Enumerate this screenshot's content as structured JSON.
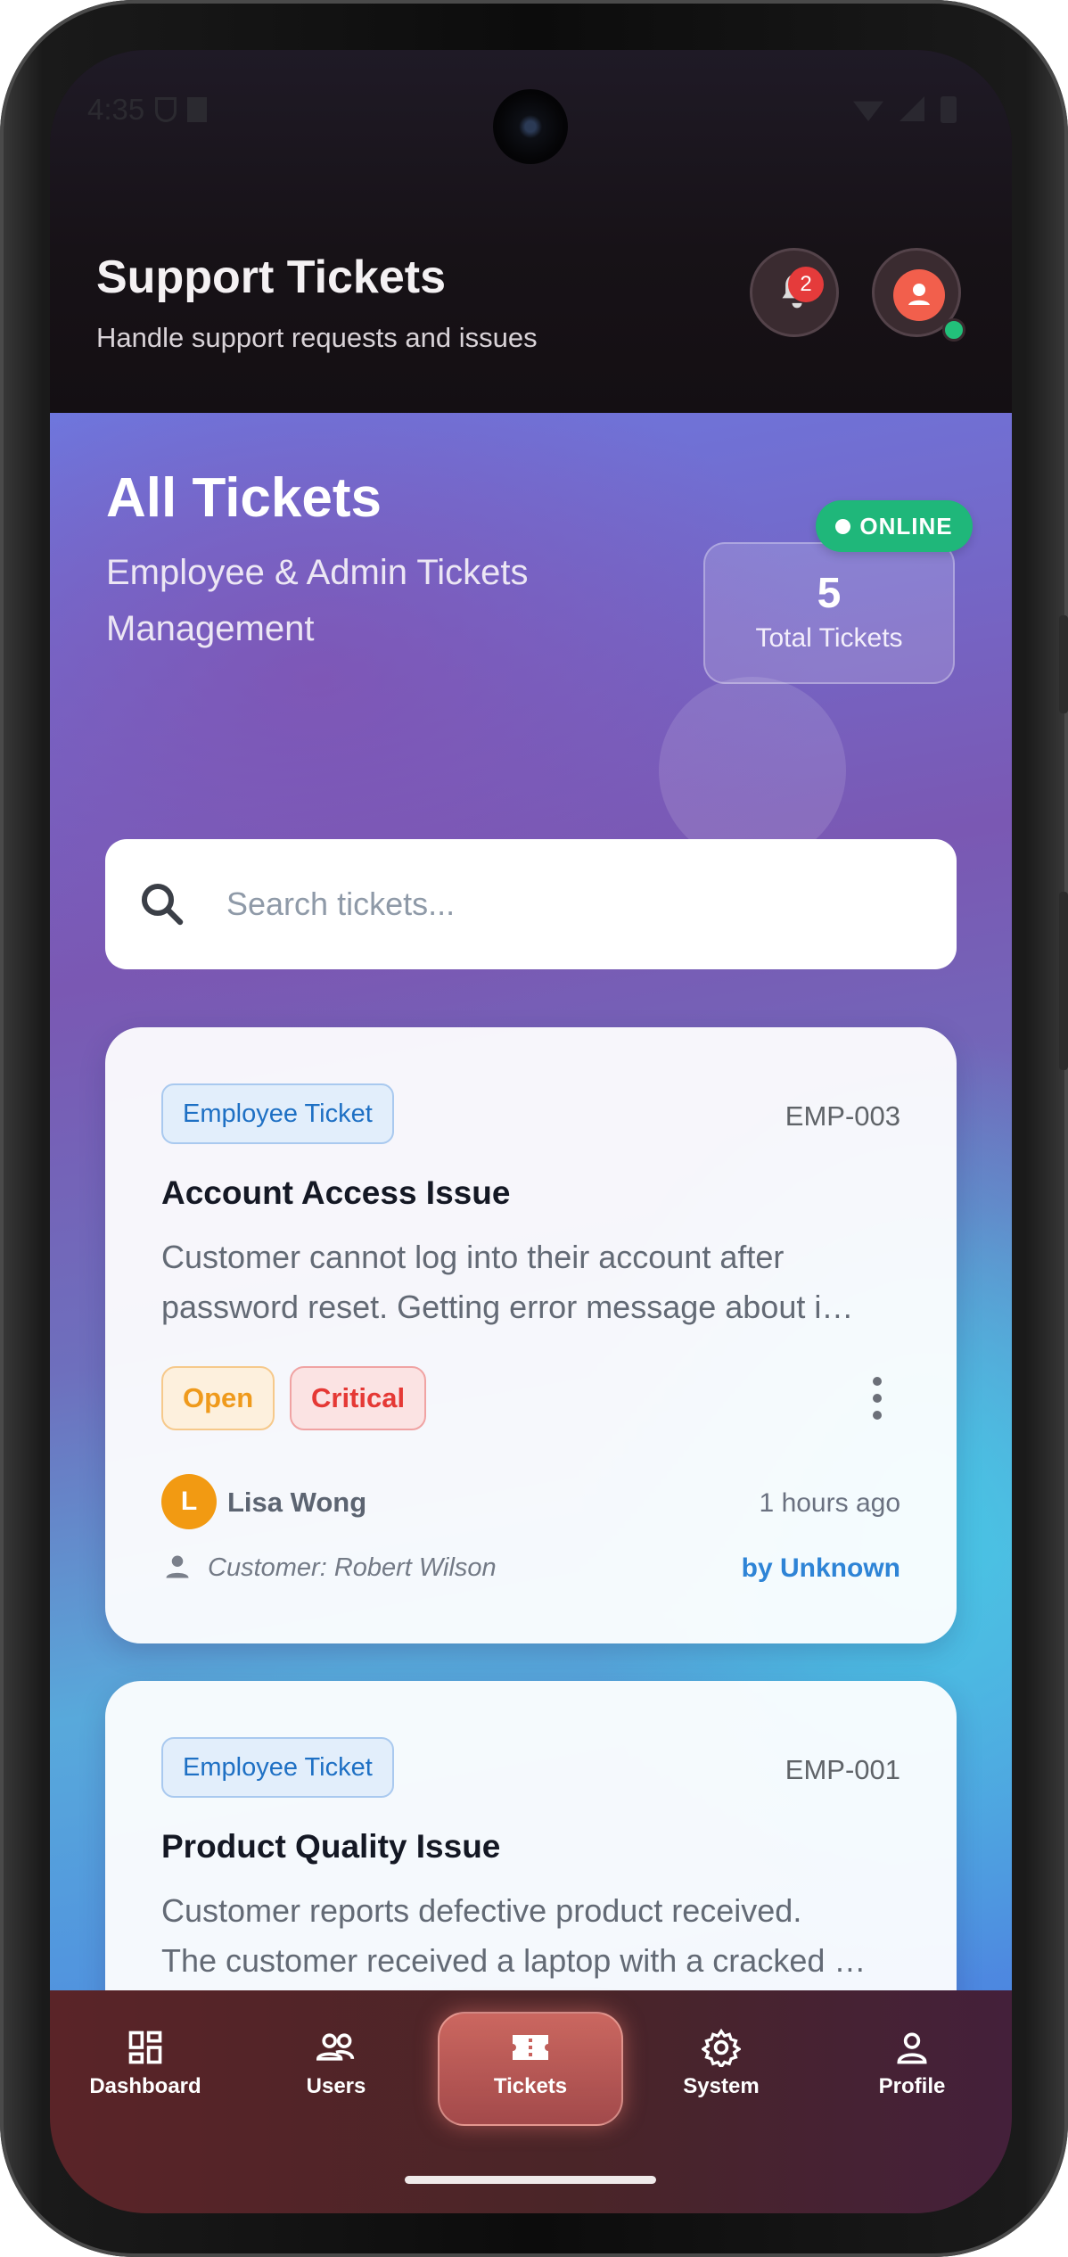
{
  "status_bar": {
    "time": "4:35"
  },
  "header": {
    "title": "Support Tickets",
    "subtitle": "Handle support requests and issues",
    "notification_count": "2"
  },
  "hero": {
    "title": "All Tickets",
    "subtitle": "Employee & Admin Tickets Management",
    "total_count": "5",
    "total_label": "Total Tickets",
    "online_label": "ONLINE"
  },
  "search": {
    "placeholder": "Search tickets..."
  },
  "tickets": [
    {
      "type": "Employee Ticket",
      "id": "EMP-003",
      "title": "Account Access Issue",
      "desc_line1": "Customer cannot log into their account after",
      "desc_line2": "password reset. Getting error message about i…",
      "status": "Open",
      "priority": "Critical",
      "assignee_initial": "L",
      "assignee": "Lisa Wong",
      "time": "1 hours ago",
      "customer": "Customer: Robert Wilson",
      "created_by": "by Unknown"
    },
    {
      "type": "Employee Ticket",
      "id": "EMP-001",
      "title": "Product Quality Issue",
      "desc_line1": "Customer reports defective product received.",
      "desc_line2": "The customer received a laptop with a cracked …"
    }
  ],
  "nav": {
    "items": [
      {
        "label": "Dashboard",
        "icon": "dashboard-icon"
      },
      {
        "label": "Users",
        "icon": "users-icon"
      },
      {
        "label": "Tickets",
        "icon": "ticket-icon",
        "active": true
      },
      {
        "label": "System",
        "icon": "gear-icon"
      },
      {
        "label": "Profile",
        "icon": "person-icon"
      }
    ]
  },
  "colors": {
    "accent": "#1e70c4",
    "online": "#1fb77a",
    "open": "#ef9a1c",
    "critical": "#e53935"
  }
}
